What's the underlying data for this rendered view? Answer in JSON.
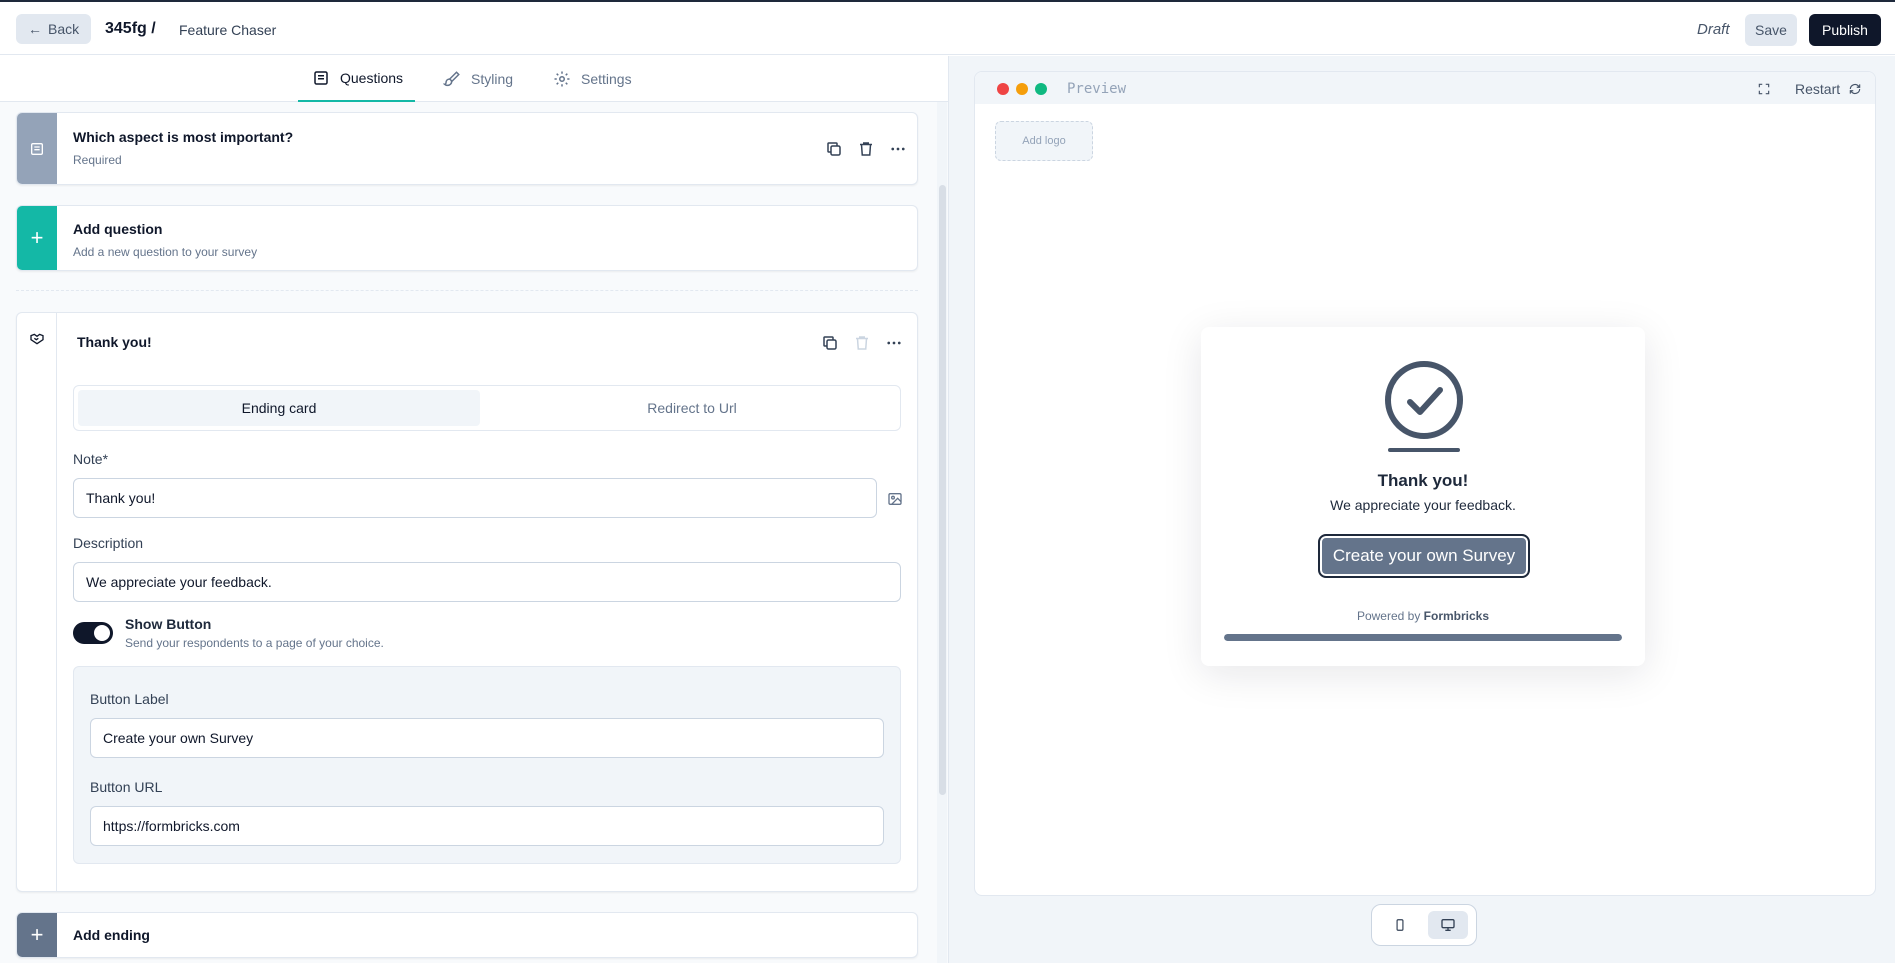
{
  "topbar": {
    "back_label": "Back",
    "survey_id": "345fg /",
    "survey_name": "Feature Chaser",
    "status": "Draft",
    "save_label": "Save",
    "publish_label": "Publish"
  },
  "tabs": [
    {
      "label": "Questions",
      "icon": "list-icon",
      "active": true
    },
    {
      "label": "Styling",
      "icon": "paintbrush-icon",
      "active": false
    },
    {
      "label": "Settings",
      "icon": "gear-icon",
      "active": false
    }
  ],
  "question_card": {
    "title": "Which aspect is most important?",
    "subtitle": "Required",
    "strip_color": "#94a3b8"
  },
  "add_question": {
    "title": "Add question",
    "subtitle": "Add a new question to your survey",
    "strip_color": "#14b8a6"
  },
  "ending_card": {
    "title": "Thank you!",
    "segments": [
      "Ending card",
      "Redirect to Url"
    ],
    "selected_segment": "Ending card",
    "note_label": "Note*",
    "note_value": "Thank you!",
    "description_label": "Description",
    "description_value": "We appreciate your feedback.",
    "show_button_label": "Show Button",
    "show_button_help": "Send your respondents to a page of your choice.",
    "show_button_enabled": true,
    "button_label_label": "Button Label",
    "button_label_value": "Create your own Survey",
    "button_url_label": "Button URL",
    "button_url_value": "https://formbricks.com"
  },
  "add_ending": {
    "title": "Add ending",
    "strip_color": "#64748b"
  },
  "preview": {
    "label": "Preview",
    "restart_label": "Restart",
    "add_logo_label": "Add logo",
    "card_title": "Thank you!",
    "card_description": "We appreciate your feedback.",
    "card_button": "Create your own Survey",
    "powered_prefix": "Powered by",
    "powered_brand": "Formbricks",
    "progress": 1.0,
    "accent_color": "#64748b"
  },
  "device_toggle": {
    "options": [
      "mobile-icon",
      "desktop-icon"
    ],
    "selected": "desktop-icon"
  }
}
